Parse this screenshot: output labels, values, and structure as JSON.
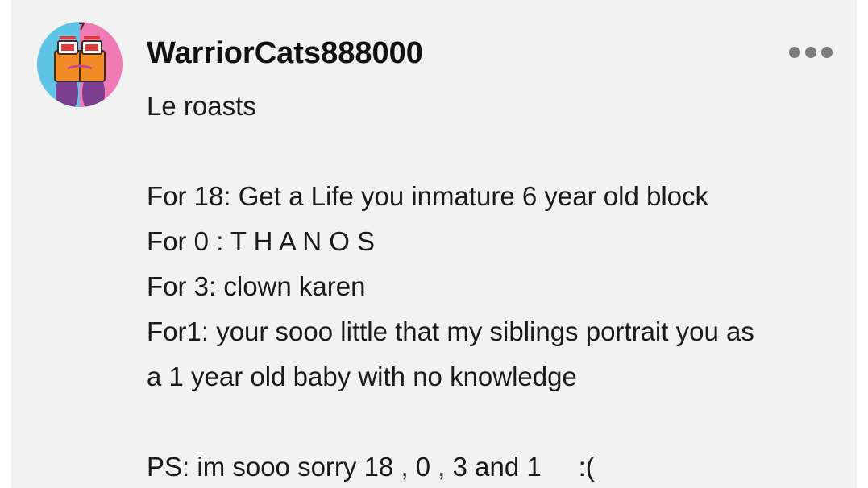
{
  "comment": {
    "username": "WarriorCats888000",
    "more_icon": "more-horizontal-icon",
    "lines": [
      "Le roasts",
      "",
      "For 18: Get a Life you inmature 6 year old block",
      "For 0 : T H A N O S",
      "For 3: clown karen",
      "For1: your sooo little that my siblings portrait you as",
      "a 1 year old baby with no knowledge",
      "",
      "PS: im sooo sorry 18 , 0 , 3 and 1     :("
    ]
  },
  "colors": {
    "card_background": "#f2f2f2",
    "text": "#1a1a1a",
    "username": "#111111",
    "icon_gray": "#7b7b7b",
    "avatar_blue": "#5ec4e6",
    "avatar_pink": "#f07ab4"
  }
}
